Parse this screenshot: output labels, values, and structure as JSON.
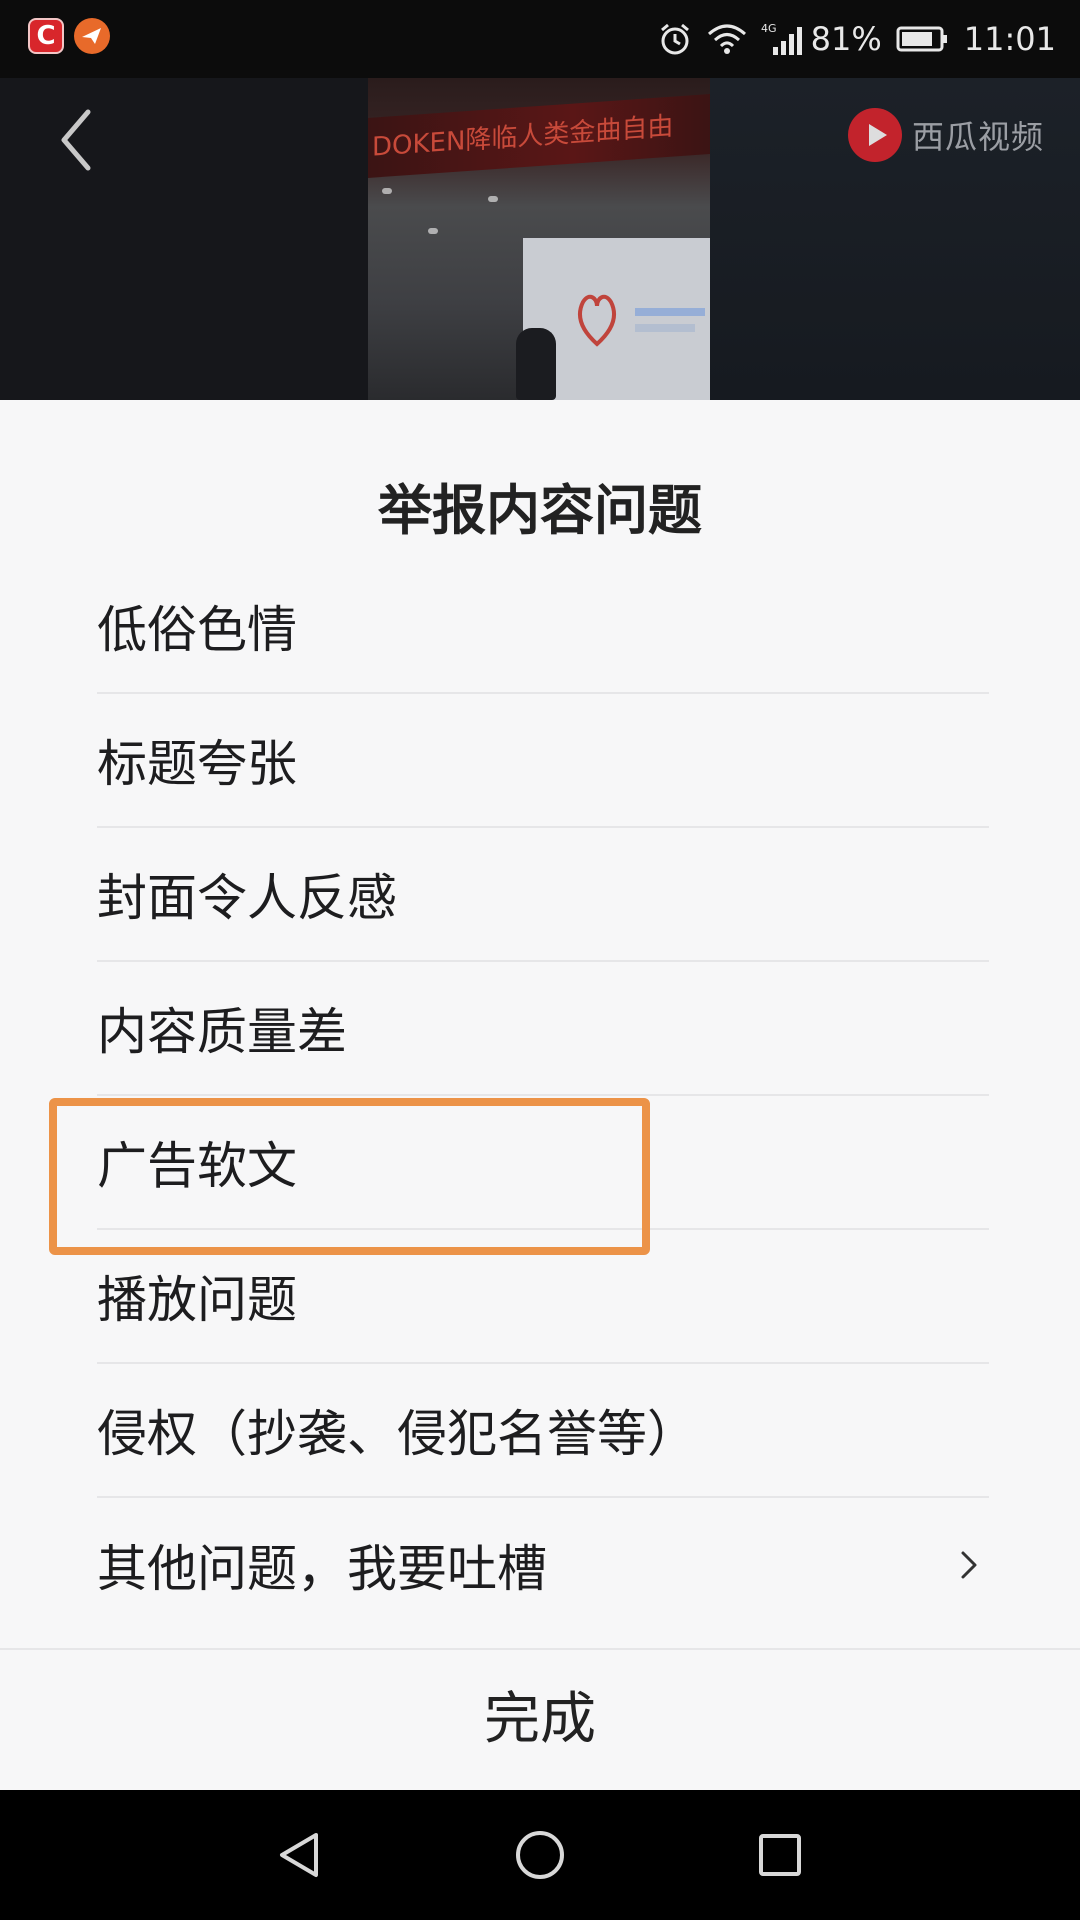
{
  "status_bar": {
    "app_icons": [
      "c-app-icon",
      "paper-plane-app-icon"
    ],
    "network": "4G",
    "battery": "81%",
    "time": "11:01"
  },
  "video": {
    "brand_label": "西瓜视频",
    "banner_text": "DOKEN降临人类金曲自由"
  },
  "sheet": {
    "title": "举报内容问题",
    "options": [
      {
        "label": "低俗色情"
      },
      {
        "label": "标题夸张"
      },
      {
        "label": "封面令人反感"
      },
      {
        "label": "内容质量差"
      },
      {
        "label": "广告软文",
        "highlighted": true
      },
      {
        "label": "播放问题"
      },
      {
        "label": "侵权（抄袭、侵犯名誉等）"
      },
      {
        "label": "其他问题，我要吐槽",
        "has_chevron": true
      }
    ],
    "done_label": "完成",
    "highlight_color": "#ec9348"
  },
  "nav_bar": {
    "buttons": [
      "back-triangle-icon",
      "home-circle-icon",
      "recents-square-icon"
    ]
  }
}
